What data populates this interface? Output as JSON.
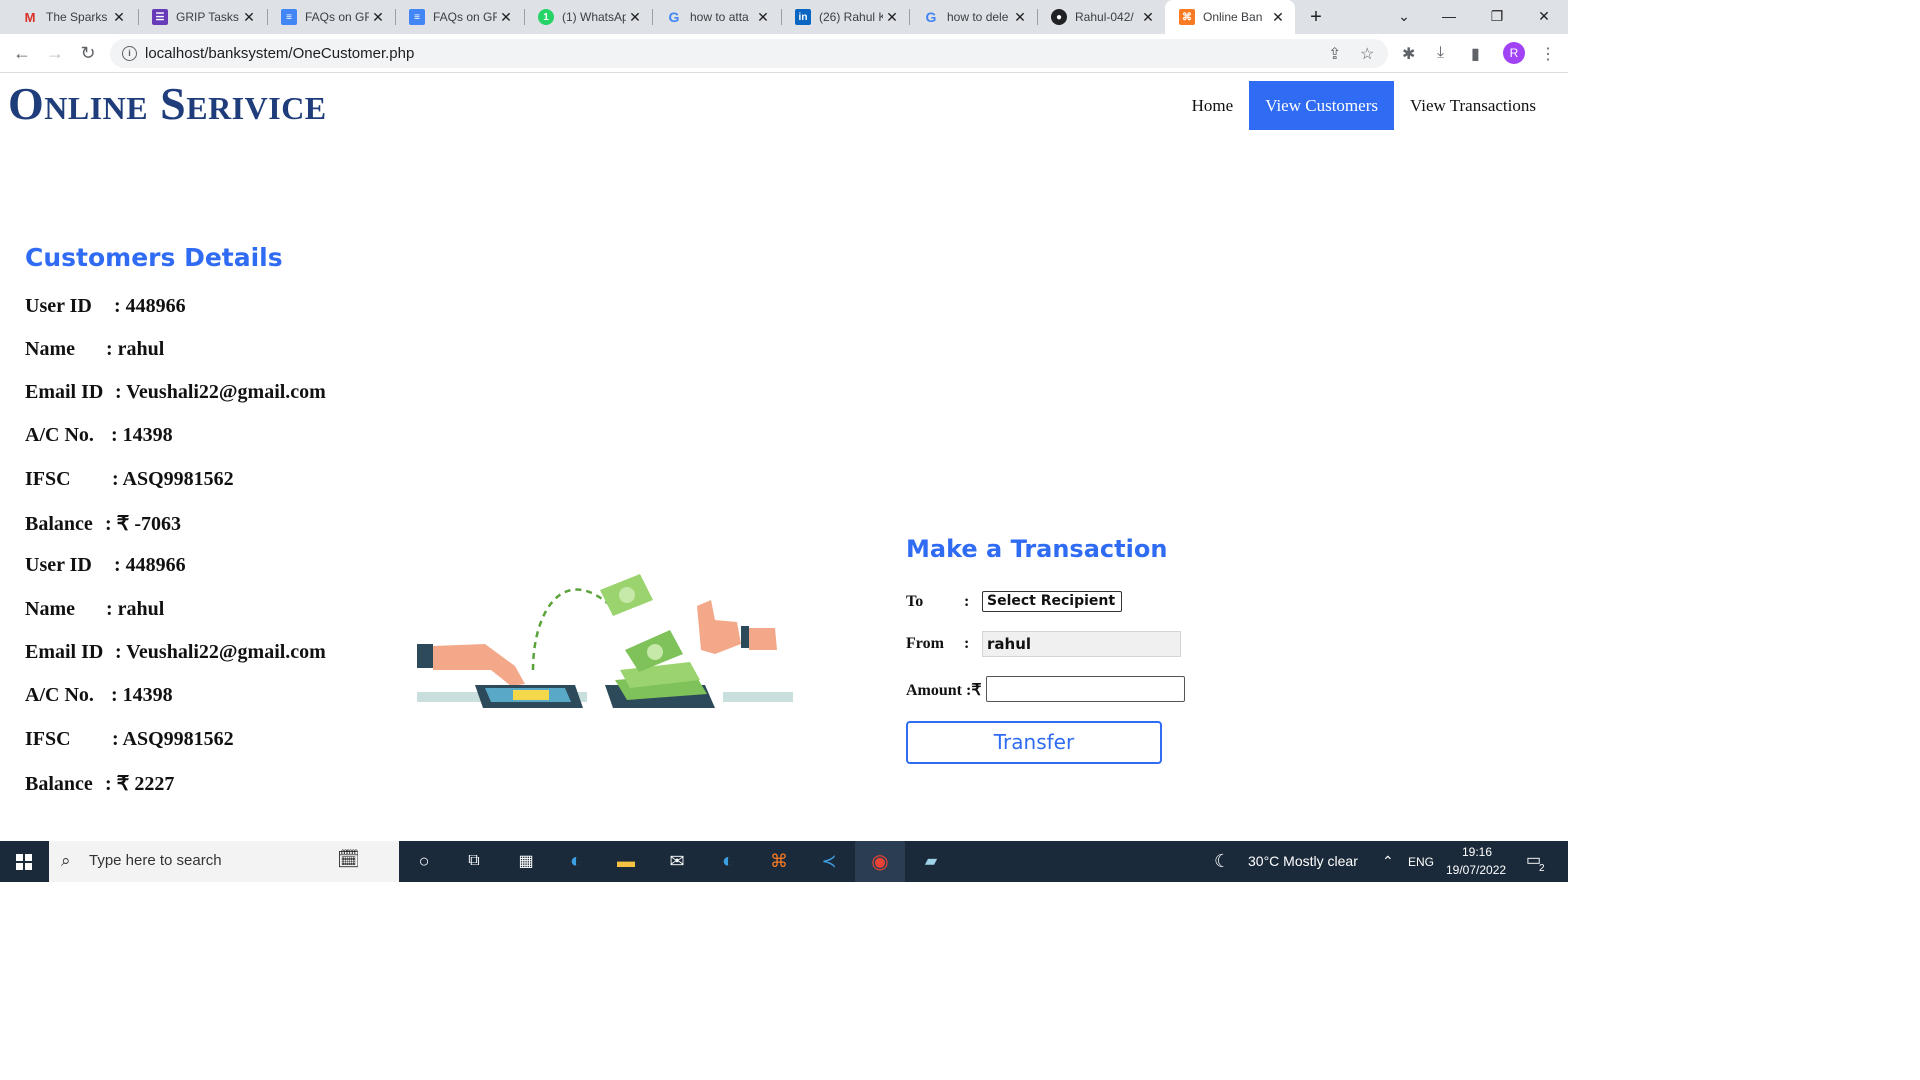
{
  "browser": {
    "tabs": [
      {
        "label": "The Sparks",
        "icon": "gmail-icon",
        "active": false
      },
      {
        "label": "GRIP Tasks",
        "icon": "forms-icon",
        "active": false
      },
      {
        "label": "FAQs on GR",
        "icon": "docs-icon",
        "active": false
      },
      {
        "label": "FAQs on GR",
        "icon": "docs-icon",
        "active": false
      },
      {
        "label": "(1) WhatsAp",
        "icon": "whatsapp-icon",
        "active": false
      },
      {
        "label": "how to atta",
        "icon": "google-icon",
        "active": false
      },
      {
        "label": "(26) Rahul K",
        "icon": "linkedin-icon",
        "active": false
      },
      {
        "label": "how to dele",
        "icon": "google-icon",
        "active": false
      },
      {
        "label": "Rahul-042/",
        "icon": "github-icon",
        "active": false
      },
      {
        "label": "Online Ban",
        "icon": "xampp-icon",
        "active": true
      }
    ],
    "url": "localhost/banksystem/OneCustomer.php",
    "profile_initial": "R"
  },
  "site": {
    "logo": "Online Serivice",
    "nav": [
      {
        "label": "Home",
        "active": false
      },
      {
        "label": "View Customers",
        "active": true
      },
      {
        "label": "View Transactions",
        "active": false
      }
    ]
  },
  "customer_details": {
    "title": "Customers Details",
    "rows": [
      {
        "label": "User ID",
        "value": ": 448966"
      },
      {
        "label": "Name",
        "value": ": rahul"
      },
      {
        "label": "Email ID",
        "value": ": Veushali22@gmail.com"
      },
      {
        "label": "A/C No.",
        "value": ": 14398"
      },
      {
        "label": "IFSC",
        "value": ": ASQ9981562"
      },
      {
        "label": "Balance",
        "value": ": ₹ -7063"
      },
      {
        "label": "User ID",
        "value": ": 448966"
      },
      {
        "label": "Name",
        "value": ": rahul"
      },
      {
        "label": "Email ID",
        "value": ": Veushali22@gmail.com"
      },
      {
        "label": "A/C No.",
        "value": ": 14398"
      },
      {
        "label": "IFSC",
        "value": ": ASQ9981562"
      },
      {
        "label": "Balance",
        "value": ": ₹ 2227"
      }
    ]
  },
  "transaction": {
    "title": "Make a Transaction",
    "to_label": "To",
    "to_colon": ":",
    "to_select": "Select Recipient",
    "from_label": "From",
    "from_colon": ":",
    "from_value": "rahul",
    "amount_label": "Amount :₹",
    "amount_value": "",
    "button": "Transfer"
  },
  "taskbar": {
    "search_placeholder": "Type here to search",
    "weather": "30°C  Mostly clear",
    "language": "ENG",
    "time": "19:16",
    "date": "19/07/2022",
    "notifications": "2"
  }
}
